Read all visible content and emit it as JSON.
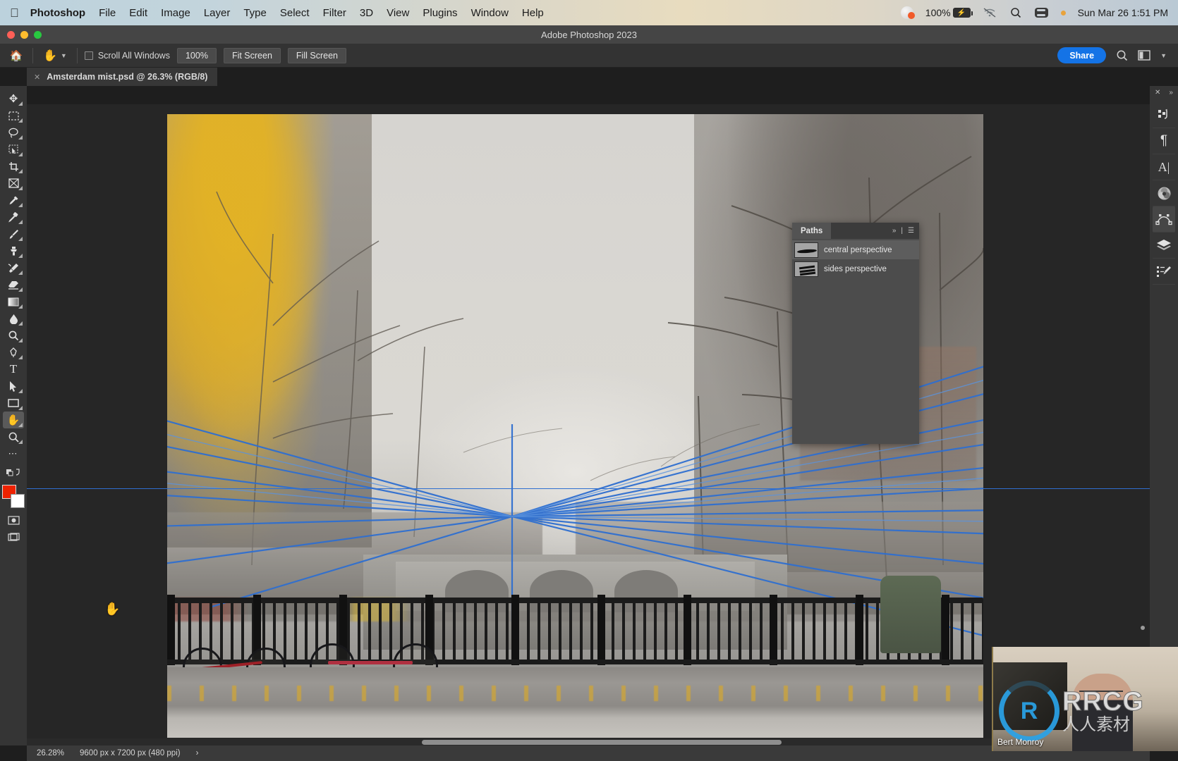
{
  "menubar": {
    "apple_icon": "apple-icon",
    "items": [
      {
        "label": "Photoshop",
        "bold": true
      },
      {
        "label": "File",
        "bold": false
      },
      {
        "label": "Edit",
        "bold": false
      },
      {
        "label": "Image",
        "bold": false
      },
      {
        "label": "Layer",
        "bold": false
      },
      {
        "label": "Type",
        "bold": false
      },
      {
        "label": "Select",
        "bold": false
      },
      {
        "label": "Filter",
        "bold": false
      },
      {
        "label": "3D",
        "bold": false
      },
      {
        "label": "View",
        "bold": false
      },
      {
        "label": "Plugins",
        "bold": false
      },
      {
        "label": "Window",
        "bold": false
      },
      {
        "label": "Help",
        "bold": false
      }
    ],
    "status": {
      "battery_percent": "100%",
      "battery_icon": "battery-charging-icon",
      "siri_icon": "siri-icon",
      "wifi_icon": "wifi-off-icon",
      "search_icon": "spotlight-search-icon",
      "control_center_icon": "control-center-icon",
      "datetime": "Sun Mar 26  1:51 PM"
    }
  },
  "window": {
    "title": "Adobe Photoshop 2023",
    "traffic_lights": [
      "close",
      "minimize",
      "zoom"
    ]
  },
  "options_bar": {
    "home_icon": "home-icon",
    "tool_icon": "hand-tool-icon",
    "tool_dropdown_icon": "chevron-down-icon",
    "scroll_all_windows_label": "Scroll All Windows",
    "scroll_all_windows_checked": false,
    "zoom_100_label": "100%",
    "fit_screen_label": "Fit Screen",
    "fill_screen_label": "Fill Screen",
    "share_label": "Share",
    "search_icon": "search-icon",
    "workspace_icon": "workspace-layout-icon",
    "workspace_chevron_icon": "chevron-down-icon"
  },
  "document_tab": {
    "close_icon": "close-icon",
    "title": "Amsterdam mist.psd @ 26.3% (RGB/8)"
  },
  "toolbar": {
    "tools": [
      {
        "name": "move-tool",
        "glyph": "✥",
        "active": false
      },
      {
        "name": "rectangular-marquee-tool",
        "glyph": "⬚",
        "active": false
      },
      {
        "name": "lasso-tool",
        "glyph": "○",
        "active": false
      },
      {
        "name": "object-selection-tool",
        "glyph": "⬜",
        "active": false
      },
      {
        "name": "crop-tool",
        "glyph": "⌙",
        "active": false
      },
      {
        "name": "frame-tool",
        "glyph": "☒",
        "active": false
      },
      {
        "name": "eyedropper-tool",
        "glyph": "✒",
        "active": false
      },
      {
        "name": "spot-healing-brush-tool",
        "glyph": "✎",
        "active": false
      },
      {
        "name": "brush-tool",
        "glyph": "✐",
        "active": false
      },
      {
        "name": "clone-stamp-tool",
        "glyph": "⚑",
        "active": false
      },
      {
        "name": "history-brush-tool",
        "glyph": "❖",
        "active": false
      },
      {
        "name": "eraser-tool",
        "glyph": "▱",
        "active": false
      },
      {
        "name": "gradient-tool",
        "glyph": "▣",
        "active": false
      },
      {
        "name": "blur-tool",
        "glyph": "●",
        "active": false
      },
      {
        "name": "dodge-tool",
        "glyph": "⚲",
        "active": false
      },
      {
        "name": "pen-tool",
        "glyph": "✑",
        "active": false
      },
      {
        "name": "type-tool",
        "glyph": "T",
        "active": false
      },
      {
        "name": "path-selection-tool",
        "glyph": "➤",
        "active": false
      },
      {
        "name": "rectangle-tool",
        "glyph": "▭",
        "active": false
      },
      {
        "name": "hand-tool",
        "glyph": "✋",
        "active": true
      },
      {
        "name": "zoom-tool",
        "glyph": "⌕",
        "active": false
      },
      {
        "name": "edit-toolbar-more",
        "glyph": "⋯",
        "active": false
      }
    ],
    "foreground_color": "#ee2200",
    "background_color": "#ffffff",
    "quick_mask_icon": "quick-mask-icon",
    "screen_mode_icon": "screen-mode-icon"
  },
  "right_dock": {
    "close_icon": "close-icon",
    "expand_icon": "expand-panels-icon",
    "items": [
      {
        "name": "history-panel-icon",
        "glyph": "↺"
      },
      {
        "name": "paragraph-panel-icon",
        "glyph": "¶"
      },
      {
        "name": "character-panel-icon",
        "glyph": "A"
      },
      {
        "name": "color-panel-icon",
        "glyph": "◉"
      },
      {
        "name": "paths-panel-icon",
        "glyph": "⌇"
      },
      {
        "name": "layers-panel-icon",
        "glyph": "◆"
      },
      {
        "name": "adjustments-panel-icon",
        "glyph": "✒"
      }
    ]
  },
  "paths_panel": {
    "tab_label": "Paths",
    "collapse_icon": "double-chevron-right-icon",
    "menu_icon": "panel-menu-icon",
    "rows": [
      {
        "label": "central perspective",
        "selected": true
      },
      {
        "label": "sides perspective",
        "selected": false
      }
    ]
  },
  "status_bar": {
    "zoom_level": "26.28%",
    "doc_dimensions": "9600 px x 7200 px (480 ppi)",
    "expand_icon": "chevron-right-icon"
  },
  "webcam": {
    "presenter_name": "Bert Monroy",
    "watermark_main": "RRCG",
    "watermark_sub": "人人素材",
    "watermark_mark": "R"
  },
  "colors": {
    "accent_blue": "#1473e6",
    "path_line_blue": "#2f6fd0",
    "panel_gray": "#464646",
    "app_bg": "#1e1e1e"
  },
  "cursor": {
    "icon": "hand-cursor-icon",
    "glyph": "✋"
  }
}
